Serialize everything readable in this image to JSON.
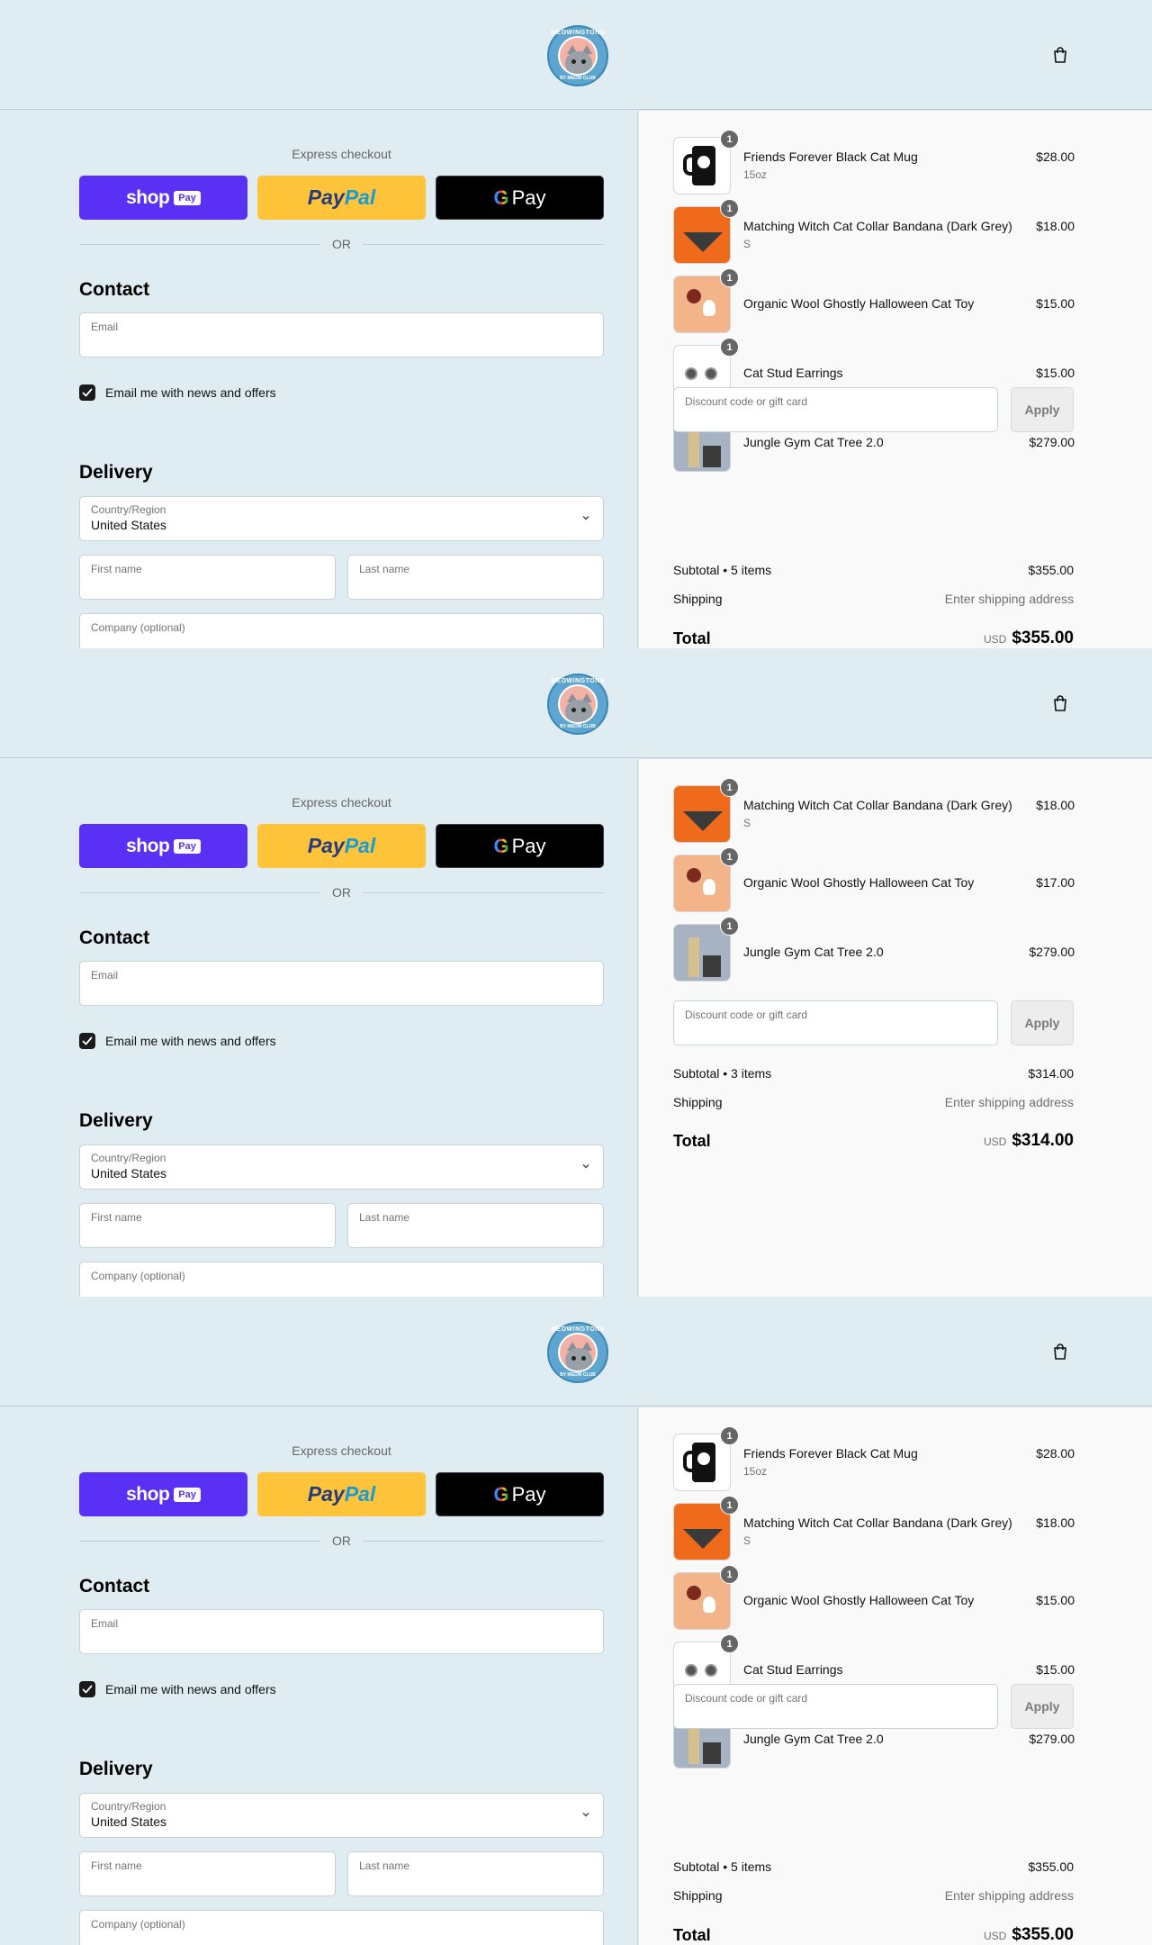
{
  "header": {
    "logo_text_top": "MEOWINGTONS",
    "logo_text_bottom": "BY MEOW CLUB"
  },
  "express": {
    "label": "Express checkout",
    "shop_word": "shop",
    "shop_chip": "Pay",
    "paypal_a": "Pay",
    "paypal_b": "Pal",
    "gpay_g": "G",
    "gpay_word": "Pay",
    "or": "OR"
  },
  "contact": {
    "title": "Contact",
    "email_label": "Email",
    "newsletter": "Email me with news and offers",
    "newsletter_checked": true
  },
  "delivery": {
    "title": "Delivery",
    "country_label": "Country/Region",
    "country_value": "United States",
    "first_name": "First name",
    "last_name": "Last name",
    "company": "Company (optional)"
  },
  "discount": {
    "placeholder": "Discount code or gift card",
    "apply": "Apply"
  },
  "panels": [
    {
      "items": [
        {
          "qty": "1",
          "name": "Friends Forever Black Cat Mug",
          "variant": "15oz",
          "price": "$28.00",
          "art": "mug"
        },
        {
          "qty": "1",
          "name": "Matching Witch Cat Collar Bandana (Dark Grey)",
          "variant": "S",
          "price": "$18.00",
          "art": "bandana"
        },
        {
          "qty": "1",
          "name": "Organic Wool Ghostly Halloween Cat Toy",
          "variant": "",
          "price": "$15.00",
          "art": "toy"
        },
        {
          "qty": "1",
          "name": "Cat Stud Earrings",
          "variant": "",
          "price": "$15.00",
          "art": "earrings"
        },
        {
          "qty": "1",
          "name": "Jungle Gym Cat Tree 2.0",
          "variant": "",
          "price": "$279.00",
          "art": "tree"
        }
      ],
      "subtotal_label": "Subtotal • 5 items",
      "subtotal": "$355.00",
      "shipping_label": "Shipping",
      "shipping": "Enter shipping address",
      "total_label": "Total",
      "currency": "USD",
      "total": "$355.00"
    },
    {
      "items": [
        {
          "qty": "1",
          "name": "Matching Witch Cat Collar Bandana (Dark Grey)",
          "variant": "S",
          "price": "$18.00",
          "art": "bandana"
        },
        {
          "qty": "1",
          "name": "Organic Wool Ghostly Halloween Cat Toy",
          "variant": "",
          "price": "$17.00",
          "art": "toy"
        },
        {
          "qty": "1",
          "name": "Jungle Gym Cat Tree 2.0",
          "variant": "",
          "price": "$279.00",
          "art": "tree"
        }
      ],
      "subtotal_label": "Subtotal • 3 items",
      "subtotal": "$314.00",
      "shipping_label": "Shipping",
      "shipping": "Enter shipping address",
      "total_label": "Total",
      "currency": "USD",
      "total": "$314.00"
    },
    {
      "items": [
        {
          "qty": "1",
          "name": "Friends Forever Black Cat Mug",
          "variant": "15oz",
          "price": "$28.00",
          "art": "mug"
        },
        {
          "qty": "1",
          "name": "Matching Witch Cat Collar Bandana (Dark Grey)",
          "variant": "S",
          "price": "$18.00",
          "art": "bandana"
        },
        {
          "qty": "1",
          "name": "Organic Wool Ghostly Halloween Cat Toy",
          "variant": "",
          "price": "$15.00",
          "art": "toy"
        },
        {
          "qty": "1",
          "name": "Cat Stud Earrings",
          "variant": "",
          "price": "$15.00",
          "art": "earrings"
        },
        {
          "qty": "1",
          "name": "Jungle Gym Cat Tree 2.0",
          "variant": "",
          "price": "$279.00",
          "art": "tree"
        }
      ],
      "subtotal_label": "Subtotal • 5 items",
      "subtotal": "$355.00",
      "shipping_label": "Shipping",
      "shipping": "Enter shipping address",
      "total_label": "Total",
      "currency": "USD",
      "total": "$355.00"
    }
  ],
  "colors": {
    "page_bg": "#dfecf2",
    "summary_bg": "#f9f9f9",
    "shop_pay": "#5a31f4",
    "paypal": "#ffc439",
    "gpay": "#000000"
  },
  "icons": {
    "cart": "shopping-bag-icon",
    "select": "chevron-down-icon",
    "check": "checkmark-icon"
  }
}
